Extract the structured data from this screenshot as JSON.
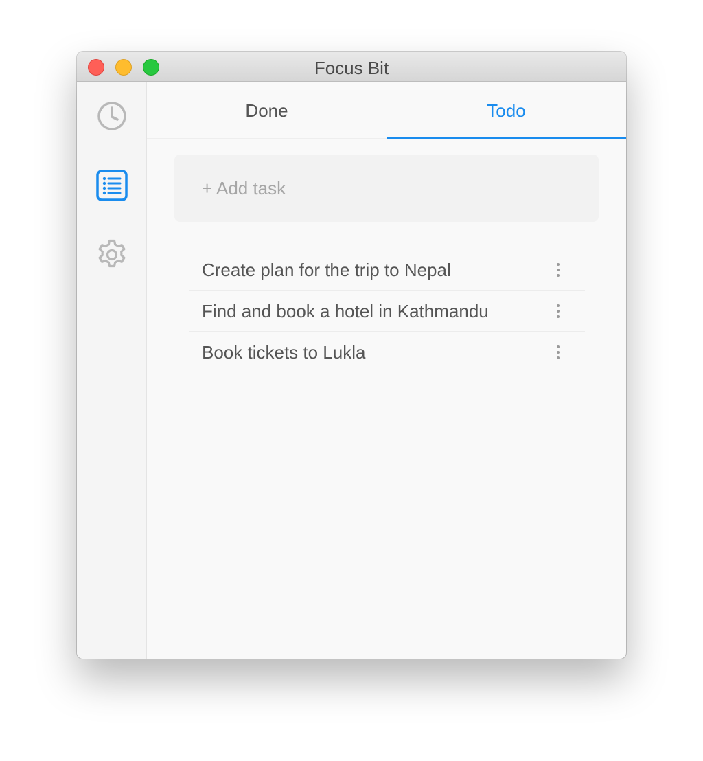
{
  "window": {
    "title": "Focus Bit"
  },
  "sidebar": {
    "items": [
      {
        "icon": "clock-icon",
        "active": false
      },
      {
        "icon": "list-icon",
        "active": true
      },
      {
        "icon": "gear-icon",
        "active": false
      }
    ]
  },
  "tabs": [
    {
      "label": "Done",
      "active": false
    },
    {
      "label": "Todo",
      "active": true
    }
  ],
  "add_task": {
    "placeholder": "+ Add task",
    "value": ""
  },
  "tasks": [
    {
      "text": "Create plan for the trip to Nepal"
    },
    {
      "text": "Find and book a hotel in Kathmandu"
    },
    {
      "text": "Book tickets to Lukla"
    }
  ],
  "colors": {
    "accent": "#1a8cee",
    "text": "#555555",
    "icon_inactive": "#b8b8b8",
    "close": "#fe5f57",
    "minimize": "#febc2e",
    "zoom": "#28c840"
  }
}
